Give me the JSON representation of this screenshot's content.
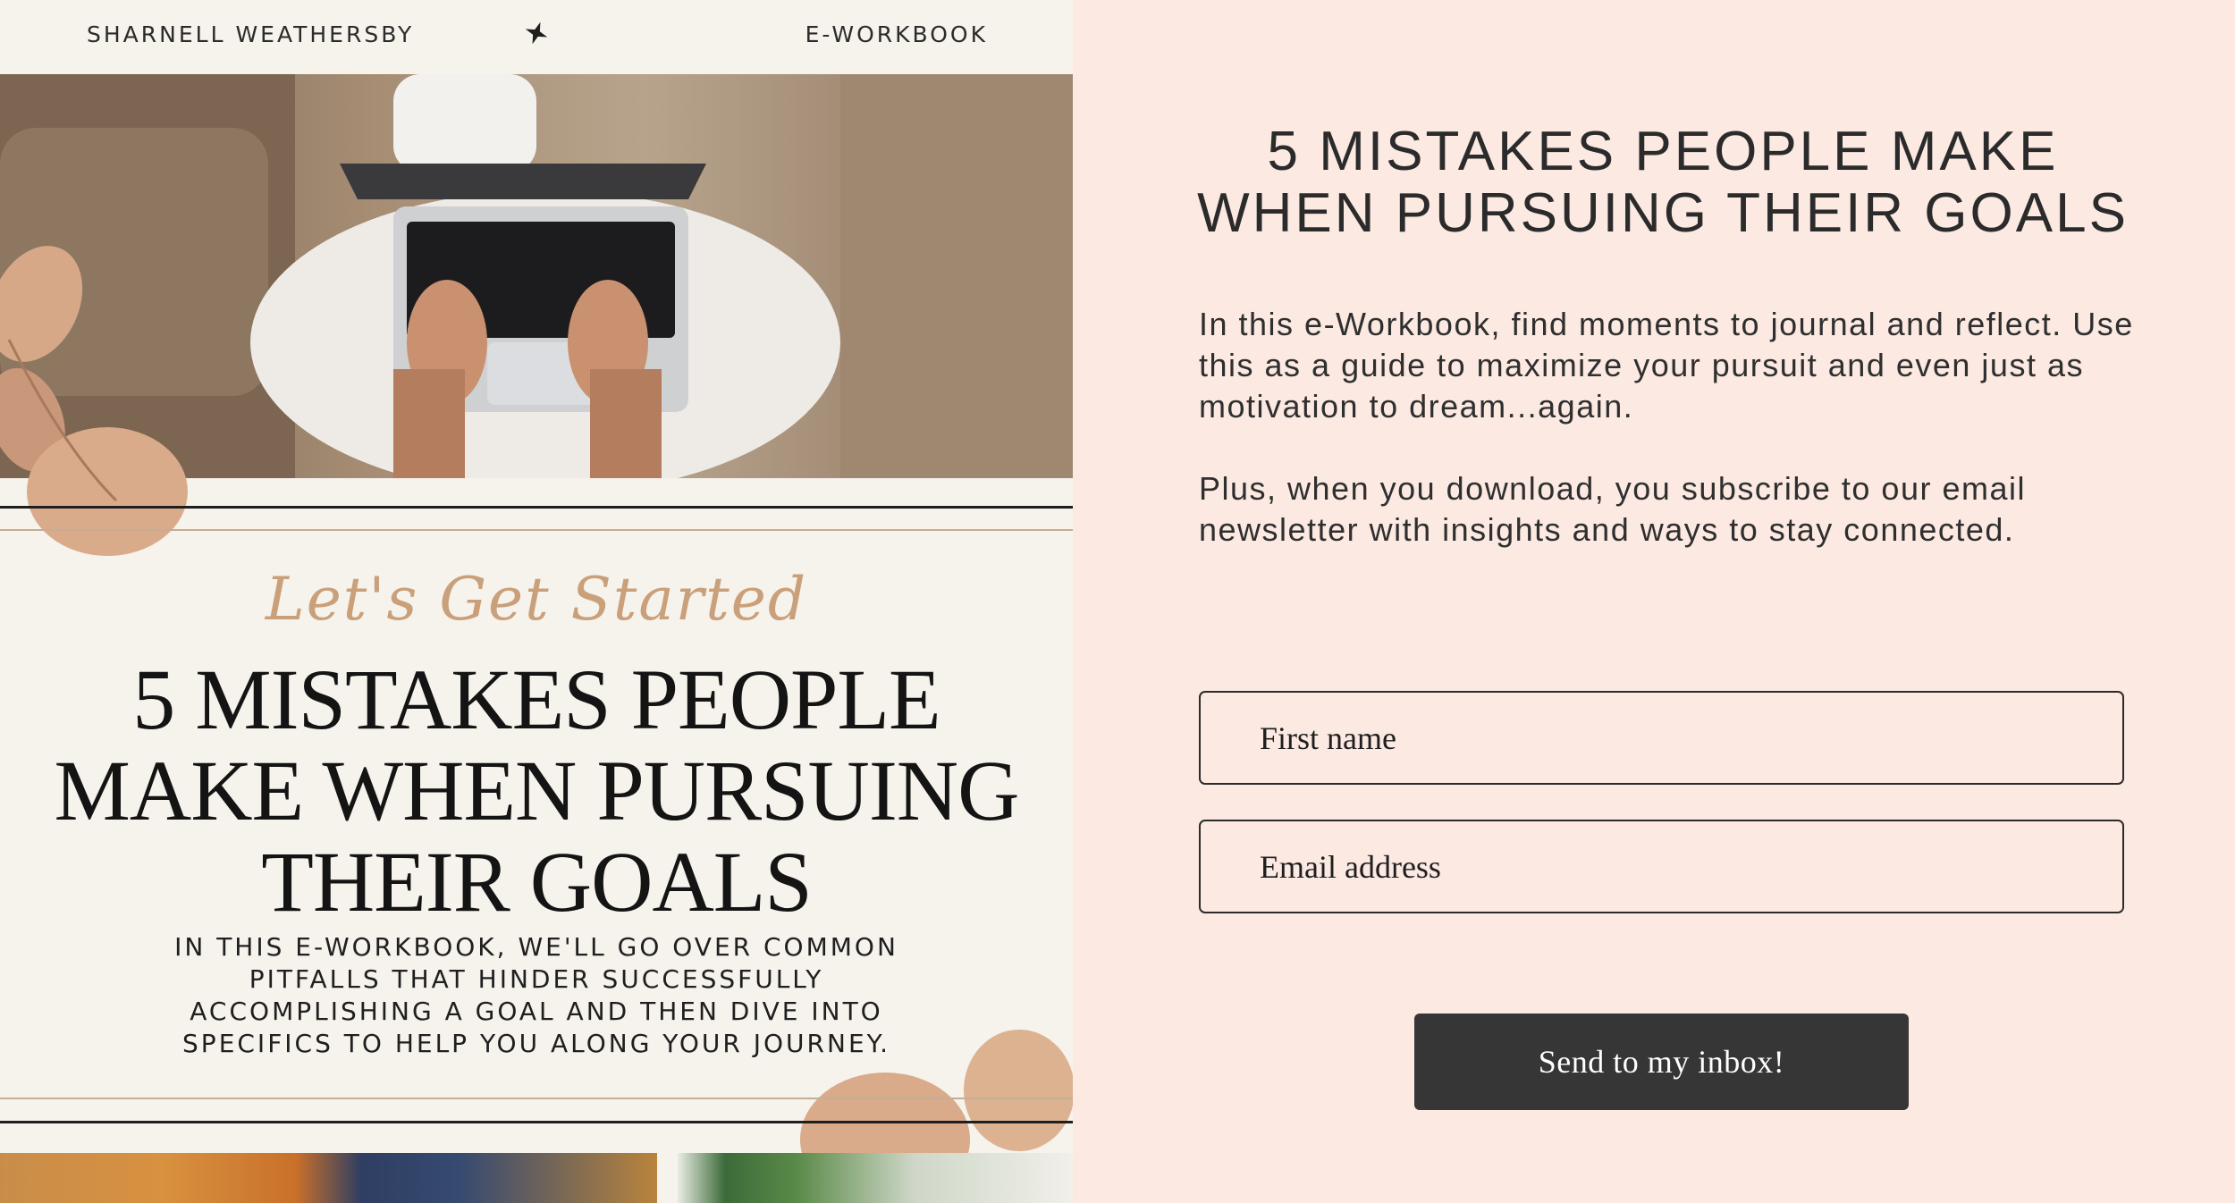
{
  "cover": {
    "author": "SHARNELL WEATHERSBY",
    "book_type": "E-WORKBOOK",
    "script_heading": "Let's Get Started",
    "title_lines": [
      "5 MISTAKES PEOPLE",
      "MAKE WHEN PURSUING",
      "THEIR GOALS"
    ],
    "subtitle_lines": [
      "IN THIS E-WORKBOOK, WE'LL GO OVER COMMON",
      "PITFALLS THAT HINDER SUCCESSFULLY",
      "ACCOMPLISHING A GOAL AND THEN DIVE INTO",
      "SPECIFICS TO HELP YOU ALONG YOUR JOURNEY."
    ]
  },
  "form": {
    "title_lines": [
      "5 MISTAKES PEOPLE MAKE",
      "WHEN PURSUING THEIR GOALS"
    ],
    "description_1": "In this e-Workbook, find moments to journal and reflect. Use this as a guide to maximize your pursuit and even just as motivation to dream...again.",
    "description_2": "Plus, when you download, you subscribe to our email newsletter with insights and ways to stay connected.",
    "first_name_placeholder": "First name",
    "email_placeholder": "Email address",
    "submit_label": "Send to my inbox!"
  },
  "colors": {
    "page_background": "#fbe9e2",
    "cover_background": "#f6f2ec",
    "accent_gold": "#c9a07a",
    "button_background": "#363636",
    "text_dark": "#2b2b2b"
  },
  "icons": {
    "header_divider": "four-point-star-icon"
  }
}
